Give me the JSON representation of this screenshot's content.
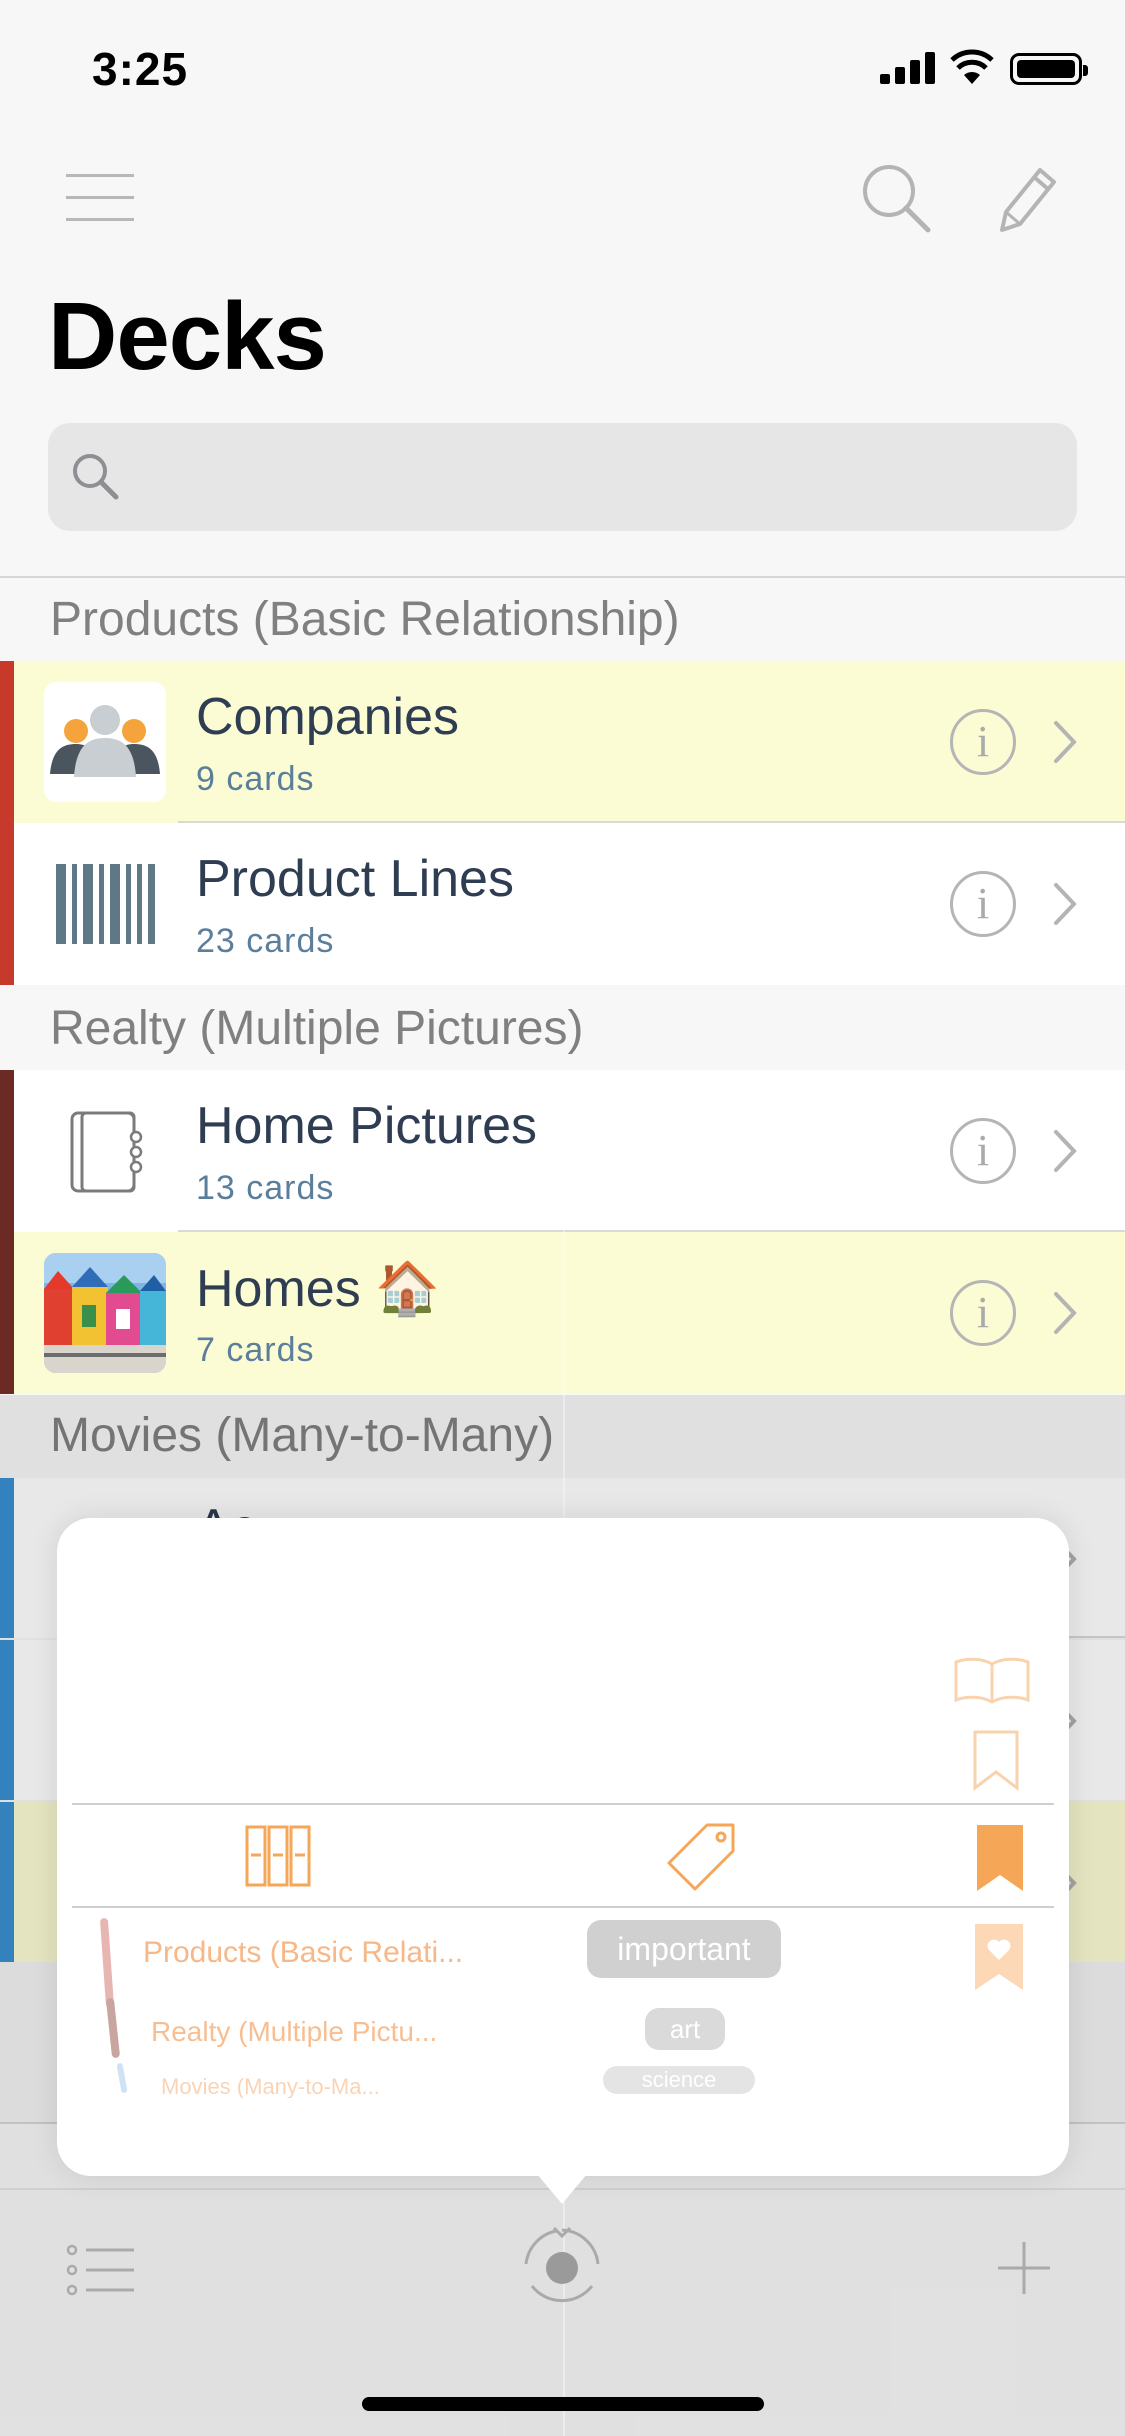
{
  "status_bar": {
    "time": "3:25"
  },
  "nav": {
    "title": "Decks"
  },
  "search": {
    "placeholder": ""
  },
  "sections": [
    {
      "header": "Products (Basic Relationship)"
    },
    {
      "header": "Realty (Multiple Pictures)"
    },
    {
      "header": "Movies (Many-to-Many)"
    }
  ],
  "rows": [
    {
      "title": "Companies",
      "subtitle": "9 cards",
      "icon": "people-group-icon",
      "stripe_color": "#c6392b",
      "highlighted": true
    },
    {
      "title": "Product Lines",
      "subtitle": "23 cards",
      "icon": "barcode-icon",
      "stripe_color": "#c6392b",
      "highlighted": false
    },
    {
      "title": "Home Pictures",
      "subtitle": "13 cards",
      "icon": "notebook-icon",
      "stripe_color": "#6b2a24",
      "highlighted": false
    },
    {
      "title": "Homes 🏠",
      "subtitle": "7 cards",
      "icon": "houses-photo",
      "stripe_color": "#6b2a24",
      "highlighted": true
    }
  ],
  "partial_row": {
    "title": "Ac"
  },
  "popover": {
    "deck_list": [
      "Products (Basic Relati...",
      "Realty (Multiple Pictu...",
      "Movies (Many-to-Ma..."
    ],
    "tags": [
      "important",
      "art",
      "science"
    ],
    "icons": [
      "decks-icon",
      "tag-icon",
      "bookmark-filled-icon",
      "open-book-icon",
      "bookmark-outline-icon",
      "bookmark-heart-icon"
    ]
  },
  "toolbar": {
    "icons": [
      "list-icon",
      "filter-icon",
      "plus-icon"
    ]
  },
  "colors": {
    "accent": "#f6a657",
    "text": "#2f3d52",
    "subtitle": "#5b7e9b",
    "highlight": "#fbfbd4",
    "products_stripe": "#c6392b",
    "realty_stripe": "#6b2a24",
    "movies_stripe": "#3a8fd0"
  }
}
